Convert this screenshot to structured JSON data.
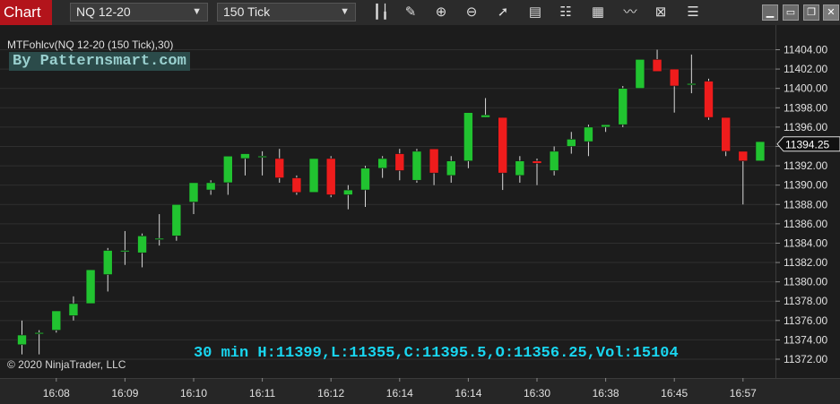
{
  "toolbar": {
    "chart_tab": "Chart",
    "instrument": "NQ 12-20",
    "interval": "150 Tick",
    "icons": [
      "bar-type-icon",
      "pencil-icon",
      "zoom-in-icon",
      "zoom-out-icon",
      "pointer-icon",
      "data-box-icon",
      "properties-icon",
      "strategies-icon",
      "indicators-icon",
      "templates-icon",
      "list-icon"
    ],
    "window_buttons": [
      "minimize-icon",
      "maximize-icon",
      "close-icon"
    ]
  },
  "indicator_label": "MTFohlcv(NQ 12-20 (150 Tick),30)",
  "watermark": "By Patternsmart.com",
  "summary_text": "30 min H:11399,L:11355,C:11395.5,O:11356.25,Vol:15104",
  "copyright": "© 2020 NinjaTrader, LLC",
  "colors": {
    "up": "#21c330",
    "down": "#ee1c1c",
    "background": "#1c1c1c",
    "summary": "#19d6f0"
  },
  "chart_data": {
    "type": "candlestick",
    "ylim": [
      11371,
      11405.5
    ],
    "y_ticks": [
      "11372.00",
      "11374.00",
      "11376.00",
      "11378.00",
      "11380.00",
      "11382.00",
      "11384.00",
      "11386.00",
      "11388.00",
      "11390.00",
      "11392.00",
      "11394.00",
      "11396.00",
      "11398.00",
      "11400.00",
      "11402.00",
      "11404.00"
    ],
    "x_ticks": [
      {
        "label": "16:08",
        "bar": 1
      },
      {
        "label": "16:09",
        "bar": 5
      },
      {
        "label": "16:10",
        "bar": 9
      },
      {
        "label": "16:11",
        "bar": 13
      },
      {
        "label": "16:12",
        "bar": 17
      },
      {
        "label": "16:14",
        "bar": 21
      },
      {
        "label": "16:14",
        "bar": 25
      },
      {
        "label": "16:30",
        "bar": 29
      },
      {
        "label": "16:38",
        "bar": 33
      },
      {
        "label": "16:45",
        "bar": 37
      },
      {
        "label": "16:57",
        "bar": 41
      }
    ],
    "last_price": "11394.25",
    "candles": [
      {
        "o": 11373.5,
        "h": 11376,
        "l": 11372.5,
        "c": 11374.5
      },
      {
        "o": 11374.75,
        "h": 11375,
        "l": 11372.5,
        "c": 11374.75
      },
      {
        "o": 11375,
        "h": 11377,
        "l": 11374.75,
        "c": 11377
      },
      {
        "o": 11376.5,
        "h": 11378.5,
        "l": 11376,
        "c": 11377.75
      },
      {
        "o": 11377.75,
        "h": 11381.25,
        "l": 11377.75,
        "c": 11381.25
      },
      {
        "o": 11380.75,
        "h": 11383.5,
        "l": 11379,
        "c": 11383.25
      },
      {
        "o": 11383.25,
        "h": 11385.25,
        "l": 11381.75,
        "c": 11383.25
      },
      {
        "o": 11383,
        "h": 11385,
        "l": 11381.5,
        "c": 11384.75
      },
      {
        "o": 11384.5,
        "h": 11387,
        "l": 11383.75,
        "c": 11384.5
      },
      {
        "o": 11384.75,
        "h": 11388,
        "l": 11384.25,
        "c": 11388
      },
      {
        "o": 11388.25,
        "h": 11390.25,
        "l": 11387,
        "c": 11390.25
      },
      {
        "o": 11389.5,
        "h": 11390.5,
        "l": 11389,
        "c": 11390.25
      },
      {
        "o": 11390.25,
        "h": 11393,
        "l": 11389,
        "c": 11393
      },
      {
        "o": 11392.75,
        "h": 11393.25,
        "l": 11391,
        "c": 11393.25
      },
      {
        "o": 11393,
        "h": 11393.5,
        "l": 11391,
        "c": 11393
      },
      {
        "o": 11392.75,
        "h": 11393.75,
        "l": 11390.25,
        "c": 11390.75
      },
      {
        "o": 11390.75,
        "h": 11391,
        "l": 11389,
        "c": 11389.25
      },
      {
        "o": 11389.25,
        "h": 11392.75,
        "l": 11389.25,
        "c": 11392.75
      },
      {
        "o": 11392.75,
        "h": 11393,
        "l": 11388.75,
        "c": 11389
      },
      {
        "o": 11389,
        "h": 11390,
        "l": 11387.5,
        "c": 11389.5
      },
      {
        "o": 11389.5,
        "h": 11392,
        "l": 11387.75,
        "c": 11391.75
      },
      {
        "o": 11391.75,
        "h": 11393,
        "l": 11390.75,
        "c": 11392.75
      },
      {
        "o": 11393.25,
        "h": 11393.75,
        "l": 11390.5,
        "c": 11391.5
      },
      {
        "o": 11390.5,
        "h": 11393.75,
        "l": 11390.25,
        "c": 11393.5
      },
      {
        "o": 11393.75,
        "h": 11393.75,
        "l": 11390,
        "c": 11391.25
      },
      {
        "o": 11391,
        "h": 11393,
        "l": 11390.25,
        "c": 11392.5
      },
      {
        "o": 11392.5,
        "h": 11397.5,
        "l": 11391.75,
        "c": 11397.5
      },
      {
        "o": 11397,
        "h": 11399,
        "l": 11397,
        "c": 11397.25
      },
      {
        "o": 11397,
        "h": 11397,
        "l": 11389.5,
        "c": 11391.25
      },
      {
        "o": 11391,
        "h": 11393,
        "l": 11390.25,
        "c": 11392.5
      },
      {
        "o": 11392.5,
        "h": 11392.75,
        "l": 11390,
        "c": 11392.25
      },
      {
        "o": 11391.5,
        "h": 11394,
        "l": 11391,
        "c": 11393.5
      },
      {
        "o": 11394,
        "h": 11395.5,
        "l": 11393.25,
        "c": 11394.75
      },
      {
        "o": 11394.5,
        "h": 11396.25,
        "l": 11393,
        "c": 11396
      },
      {
        "o": 11396,
        "h": 11396.25,
        "l": 11395.5,
        "c": 11396.25
      },
      {
        "o": 11396.25,
        "h": 11400.25,
        "l": 11396,
        "c": 11400
      },
      {
        "o": 11400,
        "h": 11403,
        "l": 11400,
        "c": 11403
      },
      {
        "o": 11403,
        "h": 11404,
        "l": 11401.75,
        "c": 11401.75
      },
      {
        "o": 11402,
        "h": 11402,
        "l": 11397.5,
        "c": 11400.25
      },
      {
        "o": 11400.5,
        "h": 11403.5,
        "l": 11399.5,
        "c": 11400.5
      },
      {
        "o": 11400.75,
        "h": 11401,
        "l": 11396.75,
        "c": 11397
      },
      {
        "o": 11397,
        "h": 11397,
        "l": 11393,
        "c": 11393.5
      },
      {
        "o": 11393.5,
        "h": 11393.5,
        "l": 11388,
        "c": 11392.5
      },
      {
        "o": 11392.5,
        "h": 11394.5,
        "l": 11392.5,
        "c": 11394.5
      }
    ]
  }
}
